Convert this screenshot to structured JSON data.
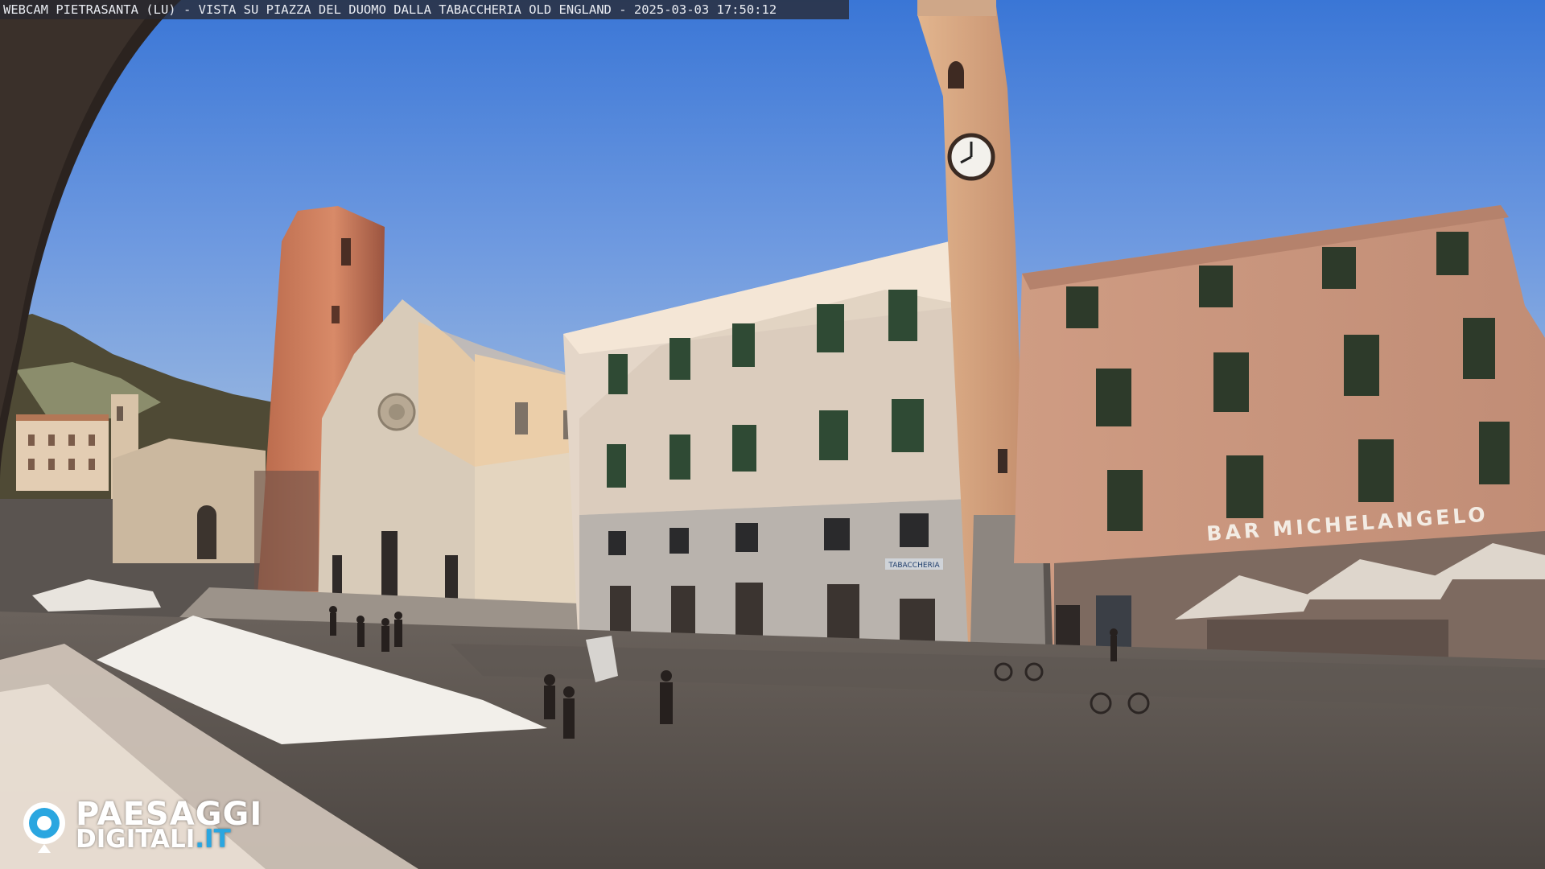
{
  "overlay": {
    "caption": "WEBCAM PIETRASANTA (LU) - VISTA SU PIAZZA DEL DUOMO DALLA TABACCHERIA OLD ENGLAND - 2025-03-03 17:50:12"
  },
  "signs": {
    "bar_sign": "BAR MICHELANGELO",
    "tabacchi_sign": "TABACCHERIA"
  },
  "logo": {
    "line1": "PAESAGGI",
    "line2_main": "DIGITALI",
    "line2_tld": ".IT",
    "icon": "eye-camera-icon"
  },
  "colors": {
    "sky_top": "#3b78d8",
    "sky_bottom": "#8fb2de",
    "logo_accent": "#2aa6e0"
  }
}
